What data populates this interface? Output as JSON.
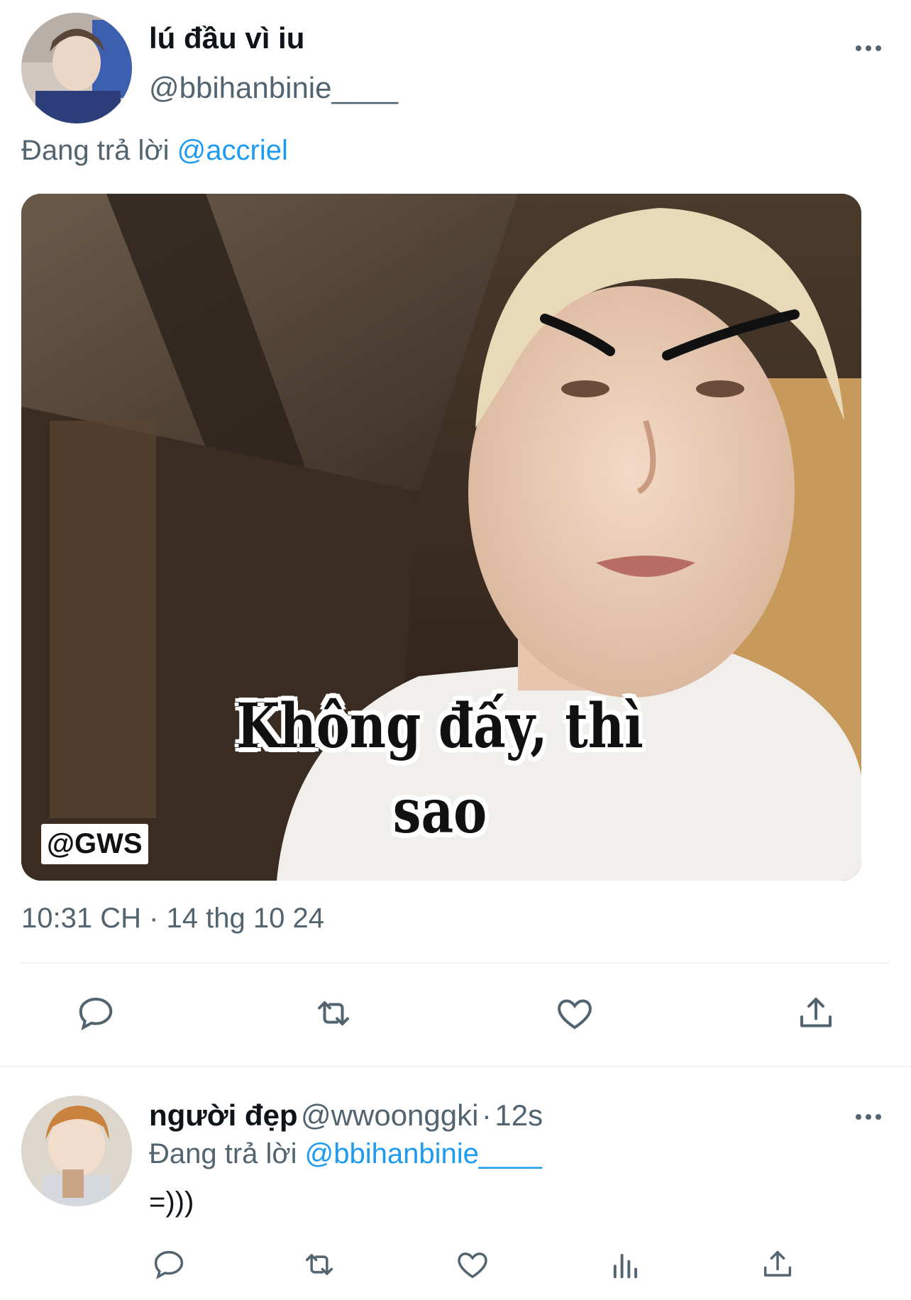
{
  "tweet": {
    "author_name": "lú đầu vì iu",
    "author_handle": "@bbihanbinie____",
    "replying_prefix": "Đang trả lời",
    "replying_to": "@accriel",
    "media": {
      "caption_line1": "Không đấy, thì",
      "caption_line2": "sao",
      "watermark": "@GWS"
    },
    "timestamp": "10:31 CH · 14 thg 10 24",
    "actions": [
      "reply-icon",
      "retweet-icon",
      "like-icon",
      "share-icon"
    ]
  },
  "reply": {
    "author_name": "người đẹp",
    "author_handle": "@wwoonggki",
    "time_sep": "·",
    "time": "12s",
    "replying_prefix": "Đang trả lời",
    "replying_to": "@bbihanbinie____",
    "text": "=)))",
    "actions": [
      "reply-icon",
      "retweet-icon",
      "like-icon",
      "views-icon",
      "share-icon"
    ]
  },
  "colors": {
    "accent": "#1d9bf0",
    "secondary_text": "#536471",
    "primary_text": "#0f1419",
    "divider": "#eff3f4"
  }
}
